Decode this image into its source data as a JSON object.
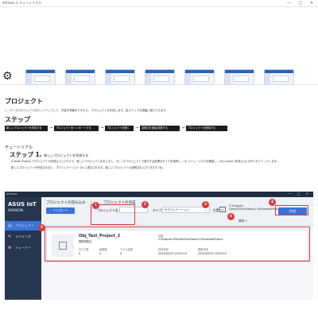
{
  "window": {
    "title": "AIVision 2 チュートリアル",
    "controls": "— □ ✕"
  },
  "toolbar": {
    "thumb_count": 7
  },
  "page": {
    "title": "プロジェクト",
    "lead": "レーザーのプロジェクトをセットアップして、学習の準備ができたら、プロジェクトを作成します。各ステップを順番に実行できます。",
    "steps_heading": "ステップ",
    "steps": [
      "新しいプロジェクトを作成する",
      "プロジェクトをインポートする",
      "プロジェクトを開く",
      "説明文を追加/変更する",
      "プロジェクトを削除する"
    ],
    "tutorial_heading": "チュートリアル",
    "step1_title": "ステップ 1.",
    "step1_sub": "新しいプロジェクトを作成する",
    "bullets": [
      "[Create Project (プロジェクトの作成)] (1) パネルで、新しいプロジェクト名を入力し、(2) このプロジェクトで実行する処理のタイプを選択し、(3) ストレージパスを確認し、(3) [Create (作成)] (4) ボタンをクリックします。",
      "新しいプロジェクトが作成されると、プロジェクトリスト (5) に表示されます。新しいプロジェクトの説明文を入力できます (6)。"
    ]
  },
  "app": {
    "title": "AIVision",
    "controls": "— □ ✕",
    "brand": "ASUS IoT",
    "product": "AIVISION",
    "nav": [
      {
        "label": "プロジェクト",
        "icon": "▤"
      },
      {
        "label": "ラベリング",
        "icon": "✎"
      },
      {
        "label": "トレーナー",
        "icon": "⚙"
      }
    ],
    "import_title": "プロジェクトの読み込み",
    "import_button": "インポート",
    "create_title": "プロジェクトの作成",
    "name_label": "プロジェクト名",
    "name_value": "",
    "type_label": "タイプ",
    "type_value": "セグメンテーション",
    "path_label": "位置",
    "path_value_line1": "C:\\Program",
    "path_value_line2": "Files\\ASUS\\AIVision\\2.0\\ExampleProje...",
    "description_label": "説明",
    "create_button": "作成",
    "card": {
      "name": "Obj_Test_Project_2",
      "type": "物体検出",
      "path_label": "位置",
      "path_value": "C:\\Program Files\\ASUS\\AIVision\\2.0\\ExampleProject",
      "stats": [
        {
          "label": "タスク数",
          "value": "0"
        },
        {
          "label": "画像数",
          "value": "0"
        },
        {
          "label": "クラス名数",
          "value": "0"
        },
        {
          "label": "作成日時",
          "value": "2022/05/25 10:03:23"
        },
        {
          "label": "更新日時",
          "value": "2022/05/25 10:03:23"
        }
      ]
    }
  },
  "callouts": [
    "1",
    "2",
    "3",
    "4",
    "5",
    "6"
  ],
  "colors": {
    "accent": "#3b73d8",
    "sidebar": "#26364f",
    "callout": "#d93a3a"
  }
}
